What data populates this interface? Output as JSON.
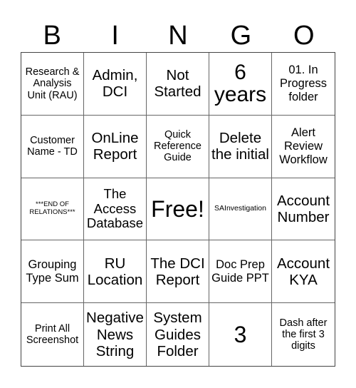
{
  "header": [
    "B",
    "I",
    "N",
    "G",
    "O"
  ],
  "cells": [
    [
      "Research & Analysis Unit (RAU)",
      "Admin, DCI",
      "Not Started",
      "6 years",
      "01. In Progress folder"
    ],
    [
      "Customer Name - TD",
      "OnLine Report",
      "Quick Reference Guide",
      "Delete the initial",
      "Alert Review Workflow"
    ],
    [
      "***END OF RELATIONS***",
      "The Access Database",
      "Free!",
      "SAInvestigation",
      "Account Number"
    ],
    [
      "Grouping Type Sum",
      "RU Location",
      "The DCI Report",
      "Doc Prep Guide PPT",
      "Account KYA"
    ],
    [
      "Print All Screenshot",
      "Negative News String",
      "System Guides Folder",
      "3",
      "Dash after the first 3 digits"
    ]
  ]
}
